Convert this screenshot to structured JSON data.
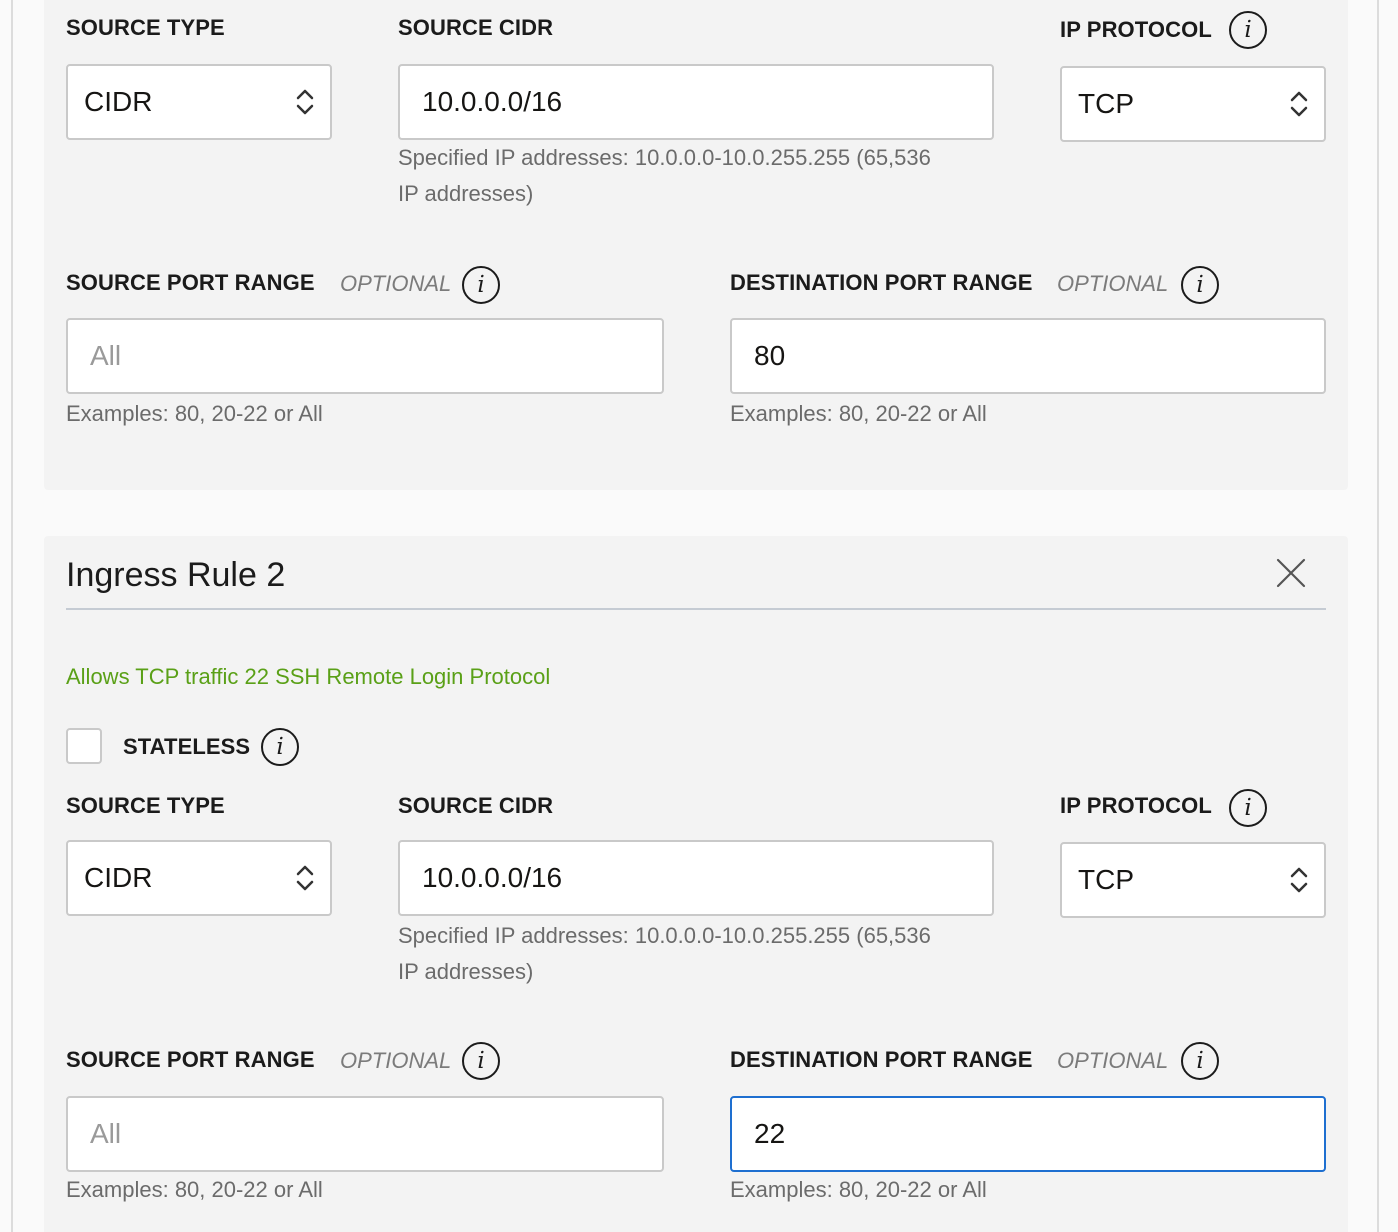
{
  "rule1": {
    "source_type": {
      "label": "SOURCE TYPE",
      "value": "CIDR"
    },
    "source_cidr": {
      "label": "SOURCE CIDR",
      "value": "10.0.0.0/16",
      "help_line1": "Specified IP addresses: 10.0.0.0-10.0.255.255 (65,536",
      "help_line2": "IP addresses)"
    },
    "ip_protocol": {
      "label": "IP PROTOCOL",
      "value": "TCP"
    },
    "source_port_range": {
      "label": "SOURCE PORT RANGE",
      "optional": "OPTIONAL",
      "placeholder": "All",
      "help": "Examples: 80, 20-22 or All"
    },
    "destination_port_range": {
      "label": "DESTINATION PORT RANGE",
      "optional": "OPTIONAL",
      "value": "80",
      "help": "Examples: 80, 20-22 or All"
    }
  },
  "rule2": {
    "title": "Ingress Rule 2",
    "description": "Allows TCP traffic 22 SSH Remote Login Protocol",
    "stateless": {
      "label": "STATELESS",
      "checked": false
    },
    "source_type": {
      "label": "SOURCE TYPE",
      "value": "CIDR"
    },
    "source_cidr": {
      "label": "SOURCE CIDR",
      "value": "10.0.0.0/16",
      "help_line1": "Specified IP addresses: 10.0.0.0-10.0.255.255 (65,536",
      "help_line2": "IP addresses)"
    },
    "ip_protocol": {
      "label": "IP PROTOCOL",
      "value": "TCP"
    },
    "source_port_range": {
      "label": "SOURCE PORT RANGE",
      "optional": "OPTIONAL",
      "placeholder": "All",
      "help": "Examples: 80, 20-22 or All"
    },
    "destination_port_range": {
      "label": "DESTINATION PORT RANGE",
      "optional": "OPTIONAL",
      "value": "22",
      "help": "Examples: 80, 20-22 or All"
    }
  },
  "icons": {
    "info": "info-icon",
    "close": "close-icon",
    "select_arrows": "chevron-up-down-icon"
  },
  "colors": {
    "description_green": "#5aa017",
    "focus_blue": "#1e6fd0",
    "panel_bg": "#f3f3f3"
  }
}
